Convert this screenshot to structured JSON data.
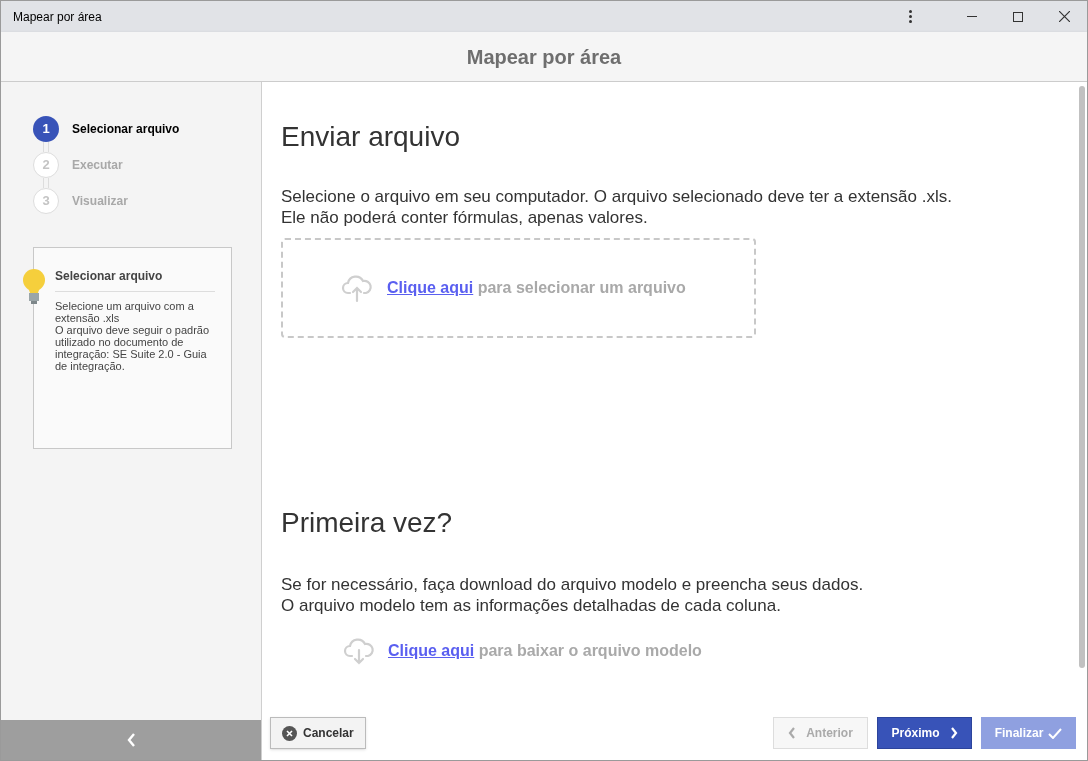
{
  "window": {
    "title": "Mapear por área"
  },
  "header": {
    "title": "Mapear por área"
  },
  "steps": [
    {
      "number": "1",
      "label": "Selecionar arquivo",
      "selected": true
    },
    {
      "number": "2",
      "label": "Executar",
      "selected": false
    },
    {
      "number": "3",
      "label": "Visualizar",
      "selected": false
    }
  ],
  "help": {
    "title": "Selecionar arquivo",
    "lines": [
      "Selecione um arquivo com a extensão .xls",
      "O arquivo deve seguir o padrão utilizado no documento de integração: SE Suite 2.0 - Guia de integração."
    ]
  },
  "upload": {
    "heading": "Enviar arquivo",
    "lines": [
      "Selecione o arquivo em seu computador. O arquivo selecionado deve ter a extensão .xls.",
      "Ele não poderá conter fórmulas, apenas valores."
    ],
    "link": "Clique aqui",
    "rest": "para selecionar um arquivo"
  },
  "first_time": {
    "heading": "Primeira vez?",
    "lines": [
      "Se for necessário, faça download do arquivo modelo e preencha seus dados.",
      "O arquivo modelo tem as informações detalhadas de cada coluna."
    ],
    "link": "Clique aqui",
    "rest": "para baixar o arquivo modelo"
  },
  "buttons": {
    "cancel": {
      "label": "Cancelar",
      "disabled": false
    },
    "previous": {
      "label": "Anterior",
      "disabled": true
    },
    "next": {
      "label": "Próximo",
      "disabled": false
    },
    "finish": {
      "label": "Finalizar",
      "disabled": true
    }
  }
}
